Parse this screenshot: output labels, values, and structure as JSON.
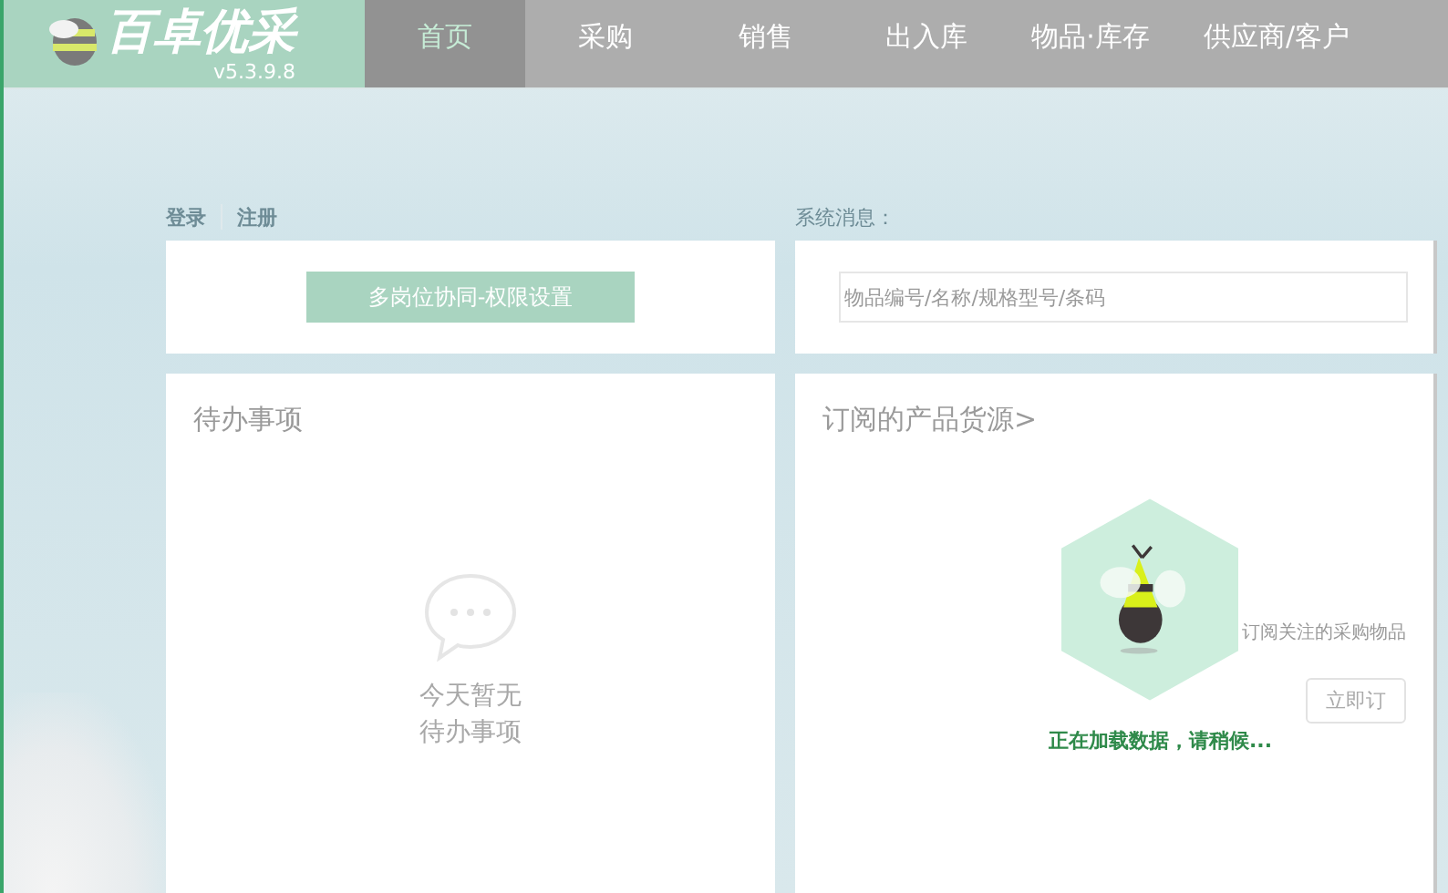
{
  "app": {
    "name": "百卓优采",
    "version": "v5.3.9.8"
  },
  "nav": [
    {
      "label": "首页",
      "selected": true
    },
    {
      "label": "采购",
      "selected": false
    },
    {
      "label": "销售",
      "selected": false
    },
    {
      "label": "出入库",
      "selected": false
    },
    {
      "label": "物品·库存",
      "selected": false
    },
    {
      "label": "供应商/客户",
      "selected": false
    }
  ],
  "account_links": [
    "登录",
    "注册"
  ],
  "permission_button": "多岗位协同-权限设置",
  "system_message": {
    "label": "系统消息：",
    "search_placeholder": "物品编号/名称/规格型号/条码"
  },
  "todo": {
    "title": "待办事项",
    "empty_lines": [
      "今天暂无",
      "待办事项"
    ]
  },
  "subscription": {
    "title": "订阅的产品货源>",
    "hint": "订阅关注的采购物品",
    "button": "立即订",
    "loading": "正在加载数据，请稍候..."
  }
}
